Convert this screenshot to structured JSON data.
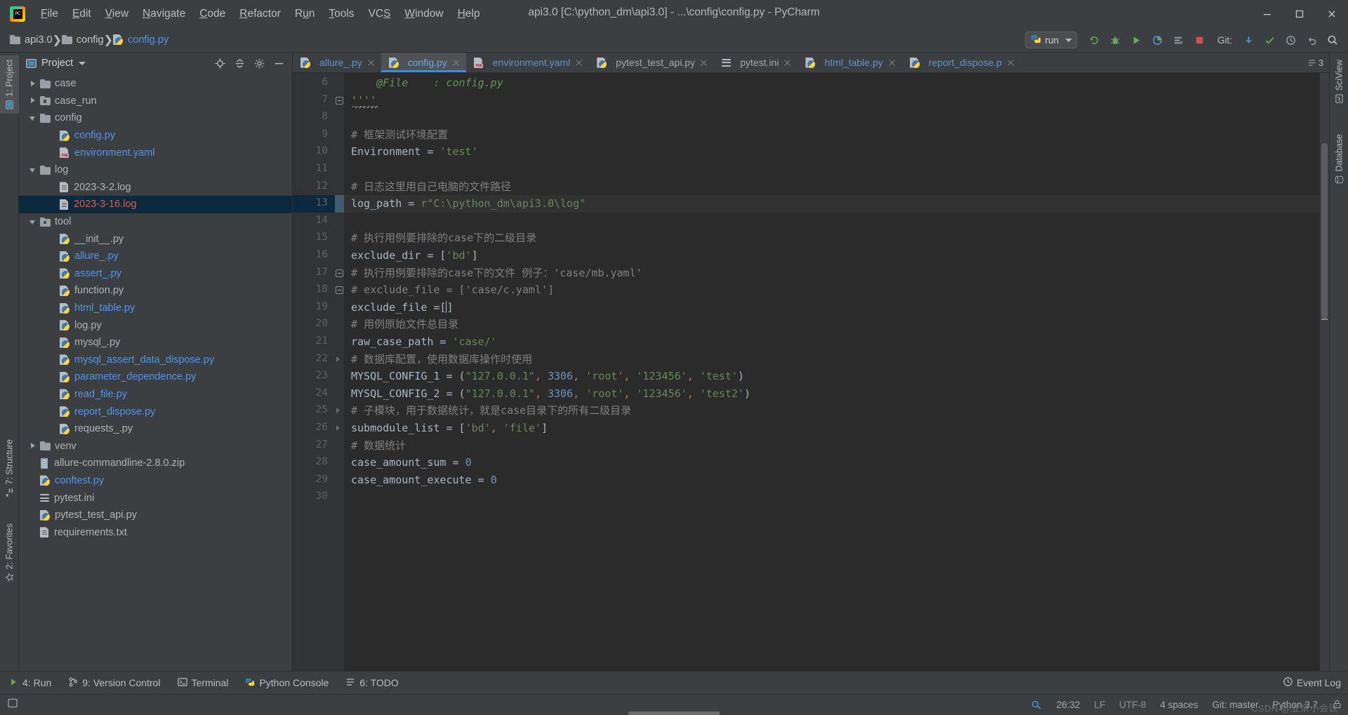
{
  "window": {
    "title": "api3.0 [C:\\python_dm\\api3.0] - ...\\config\\config.py - PyCharm",
    "logo_text": "PC",
    "minimize_icon": "minimize-icon",
    "maximize_icon": "maximize-icon",
    "close_icon": "close-icon"
  },
  "menubar": {
    "items": [
      {
        "label": "File",
        "mnemonic": "F"
      },
      {
        "label": "Edit",
        "mnemonic": "E"
      },
      {
        "label": "View",
        "mnemonic": "V"
      },
      {
        "label": "Navigate",
        "mnemonic": "N"
      },
      {
        "label": "Code",
        "mnemonic": "C"
      },
      {
        "label": "Refactor",
        "mnemonic": "R"
      },
      {
        "label": "Run",
        "mnemonic": "u"
      },
      {
        "label": "Tools",
        "mnemonic": "T"
      },
      {
        "label": "VCS",
        "mnemonic": "S"
      },
      {
        "label": "Window",
        "mnemonic": "W"
      },
      {
        "label": "Help",
        "mnemonic": "H"
      }
    ]
  },
  "navbar": {
    "breadcrumbs": [
      {
        "label": "api3.0",
        "icon": "folder-icon"
      },
      {
        "label": "config",
        "icon": "folder-icon"
      },
      {
        "label": "config.py",
        "icon": "python-file-icon"
      }
    ],
    "run_config": {
      "label": "run",
      "icon": "python-run-icon",
      "dropdown_icon": "chevron-down-icon"
    },
    "toolbar_icons": [
      "rerun-icon",
      "debug-icon",
      "run-icon",
      "coverage-icon",
      "profile-icon",
      "stop-icon"
    ],
    "git_label": "Git:",
    "git_icons": [
      "update-project-icon",
      "commit-icon",
      "history-icon",
      "rollback-icon"
    ],
    "search_icon": "search-icon"
  },
  "left_rail": {
    "items": [
      {
        "label": "1: Project",
        "icon": "project-icon",
        "active": true
      },
      {
        "label": "2: Favorites",
        "icon": "favorites-icon",
        "active": false
      },
      {
        "label": "7: Structure",
        "icon": "structure-icon",
        "active": false
      }
    ]
  },
  "right_rail": {
    "items": [
      {
        "label": "SciView",
        "icon": "sciview-icon"
      },
      {
        "label": "Database",
        "icon": "database-icon"
      }
    ]
  },
  "project_panel": {
    "title": "Project",
    "dropdown_icon": "chevron-down-icon",
    "actions": [
      "locate-icon",
      "collapse-all-icon",
      "settings-icon",
      "hide-icon"
    ],
    "tree": [
      {
        "label": "case",
        "indent": 1,
        "arrow": "closed",
        "icon": "folder-icon",
        "color": "grey",
        "selected": false
      },
      {
        "label": "case_run",
        "indent": 1,
        "arrow": "closed",
        "icon": "module-folder-icon",
        "color": "grey",
        "selected": false
      },
      {
        "label": "config",
        "indent": 1,
        "arrow": "open",
        "icon": "folder-icon",
        "color": "grey",
        "selected": false
      },
      {
        "label": "config.py",
        "indent": 2,
        "arrow": "none",
        "icon": "python-file-icon",
        "color": "blue",
        "selected": false
      },
      {
        "label": "environment.yaml",
        "indent": 2,
        "arrow": "none",
        "icon": "yaml-file-icon",
        "color": "blue",
        "selected": false
      },
      {
        "label": "log",
        "indent": 1,
        "arrow": "open",
        "icon": "folder-icon",
        "color": "grey",
        "selected": false
      },
      {
        "label": "2023-3-2.log",
        "indent": 2,
        "arrow": "none",
        "icon": "text-file-icon",
        "color": "grey",
        "selected": false
      },
      {
        "label": "2023-3-16.log",
        "indent": 2,
        "arrow": "none",
        "icon": "text-file-icon",
        "color": "red",
        "selected": true
      },
      {
        "label": "tool",
        "indent": 1,
        "arrow": "open",
        "icon": "module-folder-icon",
        "color": "grey",
        "selected": false
      },
      {
        "label": "__init__.py",
        "indent": 2,
        "arrow": "none",
        "icon": "python-file-icon",
        "color": "grey",
        "selected": false
      },
      {
        "label": "allure_.py",
        "indent": 2,
        "arrow": "none",
        "icon": "python-file-icon",
        "color": "blue",
        "selected": false
      },
      {
        "label": "assert_.py",
        "indent": 2,
        "arrow": "none",
        "icon": "python-file-icon",
        "color": "blue",
        "selected": false
      },
      {
        "label": "function.py",
        "indent": 2,
        "arrow": "none",
        "icon": "python-file-icon",
        "color": "grey",
        "selected": false
      },
      {
        "label": "html_table.py",
        "indent": 2,
        "arrow": "none",
        "icon": "python-file-icon",
        "color": "blue",
        "selected": false
      },
      {
        "label": "log.py",
        "indent": 2,
        "arrow": "none",
        "icon": "python-file-icon",
        "color": "grey",
        "selected": false
      },
      {
        "label": "mysql_.py",
        "indent": 2,
        "arrow": "none",
        "icon": "python-file-icon",
        "color": "grey",
        "selected": false
      },
      {
        "label": "mysql_assert_data_dispose.py",
        "indent": 2,
        "arrow": "none",
        "icon": "python-file-icon",
        "color": "blue",
        "selected": false
      },
      {
        "label": "parameter_dependence.py",
        "indent": 2,
        "arrow": "none",
        "icon": "python-file-icon",
        "color": "blue",
        "selected": false
      },
      {
        "label": "read_file.py",
        "indent": 2,
        "arrow": "none",
        "icon": "python-file-icon",
        "color": "blue",
        "selected": false
      },
      {
        "label": "report_dispose.py",
        "indent": 2,
        "arrow": "none",
        "icon": "python-file-icon",
        "color": "blue",
        "selected": false
      },
      {
        "label": "requests_.py",
        "indent": 2,
        "arrow": "none",
        "icon": "python-file-icon",
        "color": "grey",
        "selected": false
      },
      {
        "label": "venv",
        "indent": 1,
        "arrow": "closed",
        "icon": "folder-icon",
        "color": "grey",
        "selected": false
      },
      {
        "label": "allure-commandline-2.8.0.zip",
        "indent": 1,
        "arrow": "none",
        "icon": "zip-file-icon",
        "color": "grey",
        "selected": false
      },
      {
        "label": "conftest.py",
        "indent": 1,
        "arrow": "none",
        "icon": "python-file-icon",
        "color": "blue",
        "selected": false
      },
      {
        "label": "pytest.ini",
        "indent": 1,
        "arrow": "none",
        "icon": "ini-file-icon",
        "color": "grey",
        "selected": false
      },
      {
        "label": "pytest_test_api.py",
        "indent": 1,
        "arrow": "none",
        "icon": "python-file-icon",
        "color": "grey",
        "selected": false
      },
      {
        "label": "requirements.txt",
        "indent": 1,
        "arrow": "none",
        "icon": "text-file-icon",
        "color": "grey",
        "selected": false
      }
    ]
  },
  "editor": {
    "tabs": [
      {
        "label": "allure_.py",
        "icon": "python-file-icon",
        "active": false,
        "color": "blue"
      },
      {
        "label": "config.py",
        "icon": "python-file-icon",
        "active": true,
        "color": "blue"
      },
      {
        "label": "environment.yaml",
        "icon": "yaml-file-icon",
        "active": false,
        "color": "blue"
      },
      {
        "label": "pytest_test_api.py",
        "icon": "python-file-icon",
        "active": false,
        "color": "grey"
      },
      {
        "label": "pytest.ini",
        "icon": "ini-file-icon",
        "active": false,
        "color": "grey"
      },
      {
        "label": "html_table.py",
        "icon": "python-file-icon",
        "active": false,
        "color": "blue"
      },
      {
        "label": "report_dispose.p",
        "icon": "python-file-icon",
        "active": false,
        "color": "blue"
      }
    ],
    "tab_overflow_label": "3",
    "first_line_number": 6,
    "highlighted_line": 13,
    "cursor_line": 19,
    "lines": [
      {
        "n": 6,
        "segments": [
          {
            "t": "    @File    : config.py",
            "c": "doc"
          }
        ]
      },
      {
        "n": 7,
        "segments": [
          {
            "t": "''''",
            "c": "doc"
          }
        ],
        "fold": "minus",
        "squiggle": true
      },
      {
        "n": 8,
        "segments": []
      },
      {
        "n": 9,
        "segments": [
          {
            "t": "# 框架测试环境配置",
            "c": "cmt"
          }
        ]
      },
      {
        "n": 10,
        "segments": [
          {
            "t": "Environment",
            "c": "id"
          },
          {
            "t": " = ",
            "c": "op"
          },
          {
            "t": "'test'",
            "c": "str"
          }
        ]
      },
      {
        "n": 11,
        "segments": []
      },
      {
        "n": 12,
        "segments": [
          {
            "t": "# 日志这里用自己电脑的文件路径",
            "c": "cmt"
          }
        ]
      },
      {
        "n": 13,
        "segments": [
          {
            "t": "log_path",
            "c": "id"
          },
          {
            "t": " = ",
            "c": "op"
          },
          {
            "t": "r\"C:\\python_dm\\api3.0\\log\"",
            "c": "str"
          }
        ]
      },
      {
        "n": 14,
        "segments": []
      },
      {
        "n": 15,
        "segments": [
          {
            "t": "# 执行用例要排除的case下的二级目录",
            "c": "cmt"
          }
        ]
      },
      {
        "n": 16,
        "segments": [
          {
            "t": "exclude_dir",
            "c": "id"
          },
          {
            "t": " = [",
            "c": "op"
          },
          {
            "t": "'bd'",
            "c": "str"
          },
          {
            "t": "]",
            "c": "op"
          }
        ]
      },
      {
        "n": 17,
        "segments": [
          {
            "t": "# 执行用例要排除的case下的文件 例子：'case/mb.yaml'",
            "c": "cmt"
          }
        ],
        "fold": "minus"
      },
      {
        "n": 18,
        "segments": [
          {
            "t": "# exclude_file = ['case/c.yaml']",
            "c": "cmt"
          }
        ],
        "fold": "minus"
      },
      {
        "n": 19,
        "segments": [
          {
            "t": "exclude_file",
            "c": "id"
          },
          {
            "t": " =[]",
            "c": "op"
          }
        ],
        "caret_after": 3
      },
      {
        "n": 20,
        "segments": [
          {
            "t": "# 用例原始文件总目录",
            "c": "cmt"
          }
        ]
      },
      {
        "n": 21,
        "segments": [
          {
            "t": "raw_case_path",
            "c": "id"
          },
          {
            "t": " = ",
            "c": "op"
          },
          {
            "t": "'case/'",
            "c": "str"
          }
        ]
      },
      {
        "n": 22,
        "segments": [
          {
            "t": "# 数据库配置，使用数据库操作时使用",
            "c": "cmt"
          }
        ],
        "fold": "arrow"
      },
      {
        "n": 23,
        "segments": [
          {
            "t": "MYSQL_CONFIG_1",
            "c": "id"
          },
          {
            "t": " = (",
            "c": "op"
          },
          {
            "t": "\"127.0.0.1\"",
            "c": "str"
          },
          {
            "t": ",",
            "c": "comma"
          },
          {
            "t": " ",
            "c": "op"
          },
          {
            "t": "3306",
            "c": "num"
          },
          {
            "t": ",",
            "c": "comma"
          },
          {
            "t": " ",
            "c": "op"
          },
          {
            "t": "'root'",
            "c": "str"
          },
          {
            "t": ",",
            "c": "comma"
          },
          {
            "t": " ",
            "c": "op"
          },
          {
            "t": "'123456'",
            "c": "str"
          },
          {
            "t": ",",
            "c": "comma"
          },
          {
            "t": " ",
            "c": "op"
          },
          {
            "t": "'test'",
            "c": "str"
          },
          {
            "t": ")",
            "c": "op"
          }
        ]
      },
      {
        "n": 24,
        "segments": [
          {
            "t": "MYSQL_CONFIG_2",
            "c": "id"
          },
          {
            "t": " = (",
            "c": "op"
          },
          {
            "t": "\"127.0.0.1\"",
            "c": "str"
          },
          {
            "t": ",",
            "c": "comma"
          },
          {
            "t": " ",
            "c": "op"
          },
          {
            "t": "3306",
            "c": "num"
          },
          {
            "t": ",",
            "c": "comma"
          },
          {
            "t": " ",
            "c": "op"
          },
          {
            "t": "'root'",
            "c": "str"
          },
          {
            "t": ",",
            "c": "comma"
          },
          {
            "t": " ",
            "c": "op"
          },
          {
            "t": "'123456'",
            "c": "str"
          },
          {
            "t": ",",
            "c": "comma"
          },
          {
            "t": " ",
            "c": "op"
          },
          {
            "t": "'test2'",
            "c": "str"
          },
          {
            "t": ")",
            "c": "op"
          }
        ]
      },
      {
        "n": 25,
        "segments": [
          {
            "t": "# 子模块，用于数据统计，就是case目录下的所有二级目录",
            "c": "cmt"
          }
        ],
        "fold": "arrow"
      },
      {
        "n": 26,
        "segments": [
          {
            "t": "submodule_list",
            "c": "id"
          },
          {
            "t": " = [",
            "c": "op"
          },
          {
            "t": "'bd'",
            "c": "str"
          },
          {
            "t": ",",
            "c": "comma"
          },
          {
            "t": " ",
            "c": "op"
          },
          {
            "t": "'file'",
            "c": "str"
          },
          {
            "t": "]",
            "c": "op"
          }
        ],
        "fold": "arrow"
      },
      {
        "n": 27,
        "segments": [
          {
            "t": "# 数据统计",
            "c": "cmt"
          }
        ]
      },
      {
        "n": 28,
        "segments": [
          {
            "t": "case_amount_sum",
            "c": "id"
          },
          {
            "t": " = ",
            "c": "op"
          },
          {
            "t": "0",
            "c": "num"
          }
        ]
      },
      {
        "n": 29,
        "segments": [
          {
            "t": "case_amount_execute",
            "c": "id"
          },
          {
            "t": " = ",
            "c": "op"
          },
          {
            "t": "0",
            "c": "num"
          }
        ]
      },
      {
        "n": 30,
        "segments": []
      }
    ]
  },
  "bottom_bar": {
    "items": [
      {
        "label": "4: Run",
        "icon": "run-icon",
        "mnemonic": "4"
      },
      {
        "label": "9: Version Control",
        "icon": "vcs-icon",
        "mnemonic": "9"
      },
      {
        "label": "Terminal",
        "icon": "terminal-icon",
        "mnemonic": ""
      },
      {
        "label": "Python Console",
        "icon": "python-console-icon",
        "mnemonic": ""
      },
      {
        "label": "6: TODO",
        "icon": "todo-icon",
        "mnemonic": "6"
      }
    ],
    "event_log": {
      "label": "Event Log",
      "icon": "event-log-icon"
    }
  },
  "status_bar": {
    "caret_position": "26:32",
    "line_separator": "LF",
    "encoding": "UTF-8",
    "indent": "4 spaces",
    "branch": "Git: master",
    "interpreter": "Python 3.7",
    "lock_icon": "lock-icon",
    "inspection_icon": "inspection-icon",
    "watermark": "CSDN @业余小会议"
  }
}
